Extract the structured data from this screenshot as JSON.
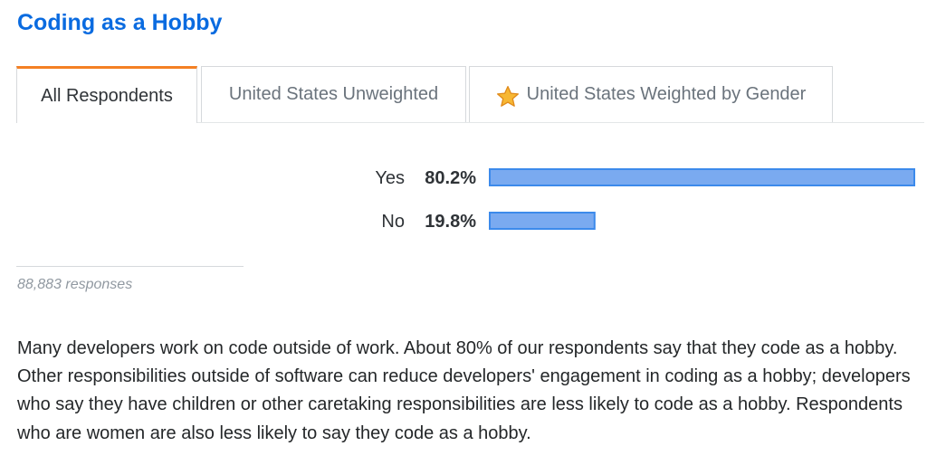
{
  "page": {
    "title": "Coding as a Hobby"
  },
  "tabs": [
    {
      "label": "All Respondents",
      "active": true
    },
    {
      "label": "United States Unweighted",
      "active": false
    },
    {
      "label": "United States Weighted by Gender",
      "active": false,
      "icon": "star-icon"
    }
  ],
  "chart_data": {
    "type": "bar",
    "orientation": "horizontal",
    "categories": [
      "Yes",
      "No"
    ],
    "values": [
      80.2,
      19.8
    ],
    "value_labels": [
      "80.2%",
      "19.8%"
    ],
    "unit": "%",
    "xlim": [
      0,
      80.2
    ],
    "grid": false,
    "colors": {
      "bar_fill": "#7aaaf0",
      "bar_border": "#3c8aeb"
    }
  },
  "responses_text": "88,883 responses",
  "description": "Many developers work on code outside of work. About 80% of our respondents say that they code as a hobby. Other responsibilities outside of software can reduce developers' engagement in coding as a hobby; developers who say they have children or other caretaking responsibilities are less likely to code as a hobby. Respondents who are women are also less likely to say they code as a hobby.",
  "colors": {
    "title": "#0a6be0",
    "tab_accent": "#f48024"
  }
}
